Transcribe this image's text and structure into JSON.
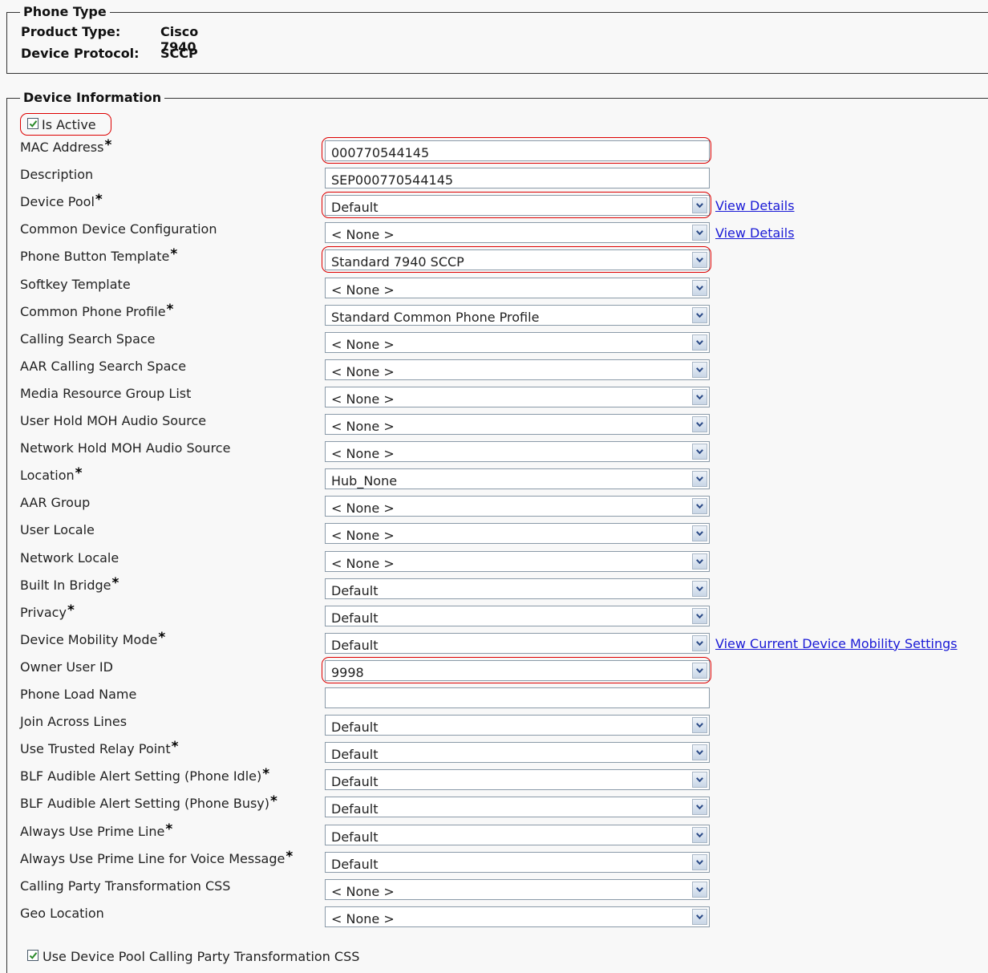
{
  "phone_type": {
    "legend": "Phone Type",
    "product_type_label": "Product Type:",
    "product_type_value": "Cisco 7940",
    "device_protocol_label": "Device Protocol:",
    "device_protocol_value": "SCCP"
  },
  "device_info": {
    "legend": "Device Information",
    "is_active": {
      "label": "Is Active",
      "checked": true
    },
    "fields": [
      {
        "label": "MAC Address",
        "required": true,
        "type": "text",
        "value": "000770544145",
        "highlight": true
      },
      {
        "label": "Description",
        "required": false,
        "type": "text",
        "value": "SEP000770544145"
      },
      {
        "label": "Device Pool",
        "required": true,
        "type": "select",
        "value": "Default",
        "highlight": true,
        "link": "View Details"
      },
      {
        "label": "Common Device Configuration",
        "required": false,
        "type": "select",
        "value": "< None >",
        "link": "View Details"
      },
      {
        "label": "Phone Button Template",
        "required": true,
        "type": "select",
        "value": "Standard 7940 SCCP",
        "highlight": true
      },
      {
        "label": "Softkey Template",
        "required": false,
        "type": "select",
        "value": "< None >"
      },
      {
        "label": "Common Phone Profile",
        "required": true,
        "type": "select",
        "value": "Standard Common Phone Profile"
      },
      {
        "label": "Calling Search Space",
        "required": false,
        "type": "select",
        "value": "< None >"
      },
      {
        "label": "AAR Calling Search Space",
        "required": false,
        "type": "select",
        "value": "< None >"
      },
      {
        "label": "Media Resource Group List",
        "required": false,
        "type": "select",
        "value": "< None >"
      },
      {
        "label": "User Hold MOH Audio Source",
        "required": false,
        "type": "select",
        "value": "< None >"
      },
      {
        "label": "Network Hold MOH Audio Source",
        "required": false,
        "type": "select",
        "value": "< None >"
      },
      {
        "label": "Location",
        "required": true,
        "type": "select",
        "value": "Hub_None"
      },
      {
        "label": "AAR Group",
        "required": false,
        "type": "select",
        "value": "< None >"
      },
      {
        "label": "User Locale",
        "required": false,
        "type": "select",
        "value": "< None >"
      },
      {
        "label": "Network Locale",
        "required": false,
        "type": "select",
        "value": "< None >"
      },
      {
        "label": "Built In Bridge",
        "required": true,
        "type": "select",
        "value": "Default"
      },
      {
        "label": "Privacy",
        "required": true,
        "type": "select",
        "value": "Default"
      },
      {
        "label": "Device Mobility Mode",
        "required": true,
        "type": "select",
        "value": "Default",
        "link": "View Current Device Mobility Settings"
      },
      {
        "label": "Owner User ID",
        "required": false,
        "type": "select",
        "value": "9998",
        "highlight": true
      },
      {
        "label": "Phone Load Name",
        "required": false,
        "type": "text",
        "value": ""
      },
      {
        "label": "Join Across Lines",
        "required": false,
        "type": "select",
        "value": "Default"
      },
      {
        "label": "Use Trusted Relay Point",
        "required": true,
        "type": "select",
        "value": "Default"
      },
      {
        "label": "BLF Audible Alert Setting (Phone Idle)",
        "required": true,
        "type": "select",
        "value": "Default"
      },
      {
        "label": "BLF Audible Alert Setting (Phone Busy)",
        "required": true,
        "type": "select",
        "value": "Default"
      },
      {
        "label": "Always Use Prime Line",
        "required": true,
        "type": "select",
        "value": "Default"
      },
      {
        "label": "Always Use Prime Line for Voice Message",
        "required": true,
        "type": "select",
        "value": "Default"
      },
      {
        "label": "Calling Party Transformation CSS",
        "required": false,
        "type": "select",
        "value": "< None >"
      },
      {
        "label": "Geo Location",
        "required": false,
        "type": "select",
        "value": "< None >"
      }
    ],
    "use_device_pool_cpt_css": {
      "label": "Use Device Pool Calling Party Transformation CSS",
      "checked": true
    }
  },
  "colors": {
    "highlight": "#dd0000",
    "link": "#1a1ad6",
    "background": "#f8f8f8"
  },
  "icons": {
    "select_arrow": "chevron-down-icon",
    "checkbox": "checkmark-icon"
  }
}
